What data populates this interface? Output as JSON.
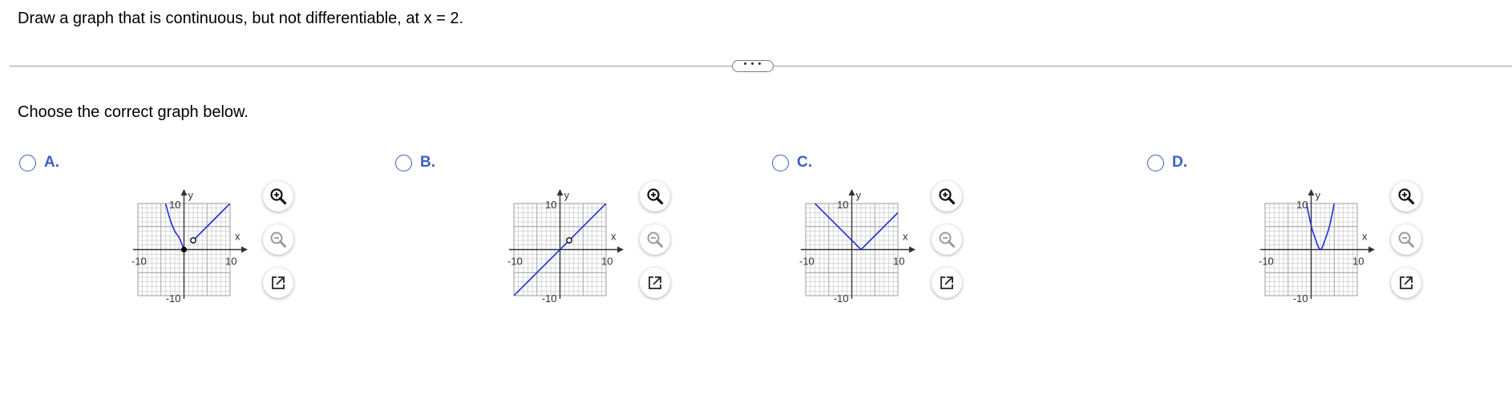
{
  "question": "Draw a graph that is continuous, but not differentiable, at x = 2.",
  "expand_label": "• • •",
  "instruction": "Choose the correct graph below.",
  "axis": {
    "x_label": "x",
    "y_label": "y",
    "min_tick": "-10",
    "max_tick": "10",
    "neg_tick": "-10"
  },
  "options": [
    {
      "letter": "A.",
      "selected": false
    },
    {
      "letter": "B.",
      "selected": false
    },
    {
      "letter": "C.",
      "selected": false
    },
    {
      "letter": "D.",
      "selected": false
    }
  ],
  "colors": {
    "accent": "#3c5dc4",
    "curve": "#1f2fd6",
    "grid": "#b5b5b5"
  },
  "icons": {
    "zoom_in": "zoom-in-icon",
    "zoom_out": "zoom-out-icon",
    "popout": "popout-icon"
  },
  "chart_data": [
    {
      "type": "line",
      "xlim": [
        -10,
        10
      ],
      "ylim": [
        -10,
        10
      ],
      "xlabel": "x",
      "ylabel": "y",
      "series": [
        {
          "x": [
            -4,
            -3,
            -2,
            -1,
            0
          ],
          "y": [
            10.0,
            6.5,
            4.0,
            2.5,
            0.0
          ]
        },
        {
          "x": [
            2,
            4,
            6,
            8,
            10
          ],
          "y": [
            2,
            4,
            6,
            8,
            10
          ]
        }
      ],
      "closed_points": [
        [
          0,
          0
        ]
      ],
      "open_points": [
        [
          2,
          2
        ]
      ]
    },
    {
      "type": "line",
      "xlim": [
        -10,
        10
      ],
      "ylim": [
        -10,
        10
      ],
      "xlabel": "x",
      "ylabel": "y",
      "series": [
        {
          "x": [
            -10,
            10
          ],
          "y": [
            -10,
            10
          ]
        }
      ],
      "closed_points": [],
      "open_points": [
        [
          2,
          2
        ]
      ]
    },
    {
      "type": "line",
      "xlim": [
        -10,
        10
      ],
      "ylim": [
        -10,
        10
      ],
      "xlabel": "x",
      "ylabel": "y",
      "series": [
        {
          "x": [
            -8,
            2,
            10
          ],
          "y": [
            10,
            0,
            8
          ]
        }
      ],
      "closed_points": [],
      "open_points": []
    },
    {
      "type": "line",
      "xlim": [
        -10,
        10
      ],
      "ylim": [
        -10,
        10
      ],
      "xlabel": "x",
      "ylabel": "y",
      "series": [
        {
          "x": [
            -1,
            0,
            1,
            2,
            3,
            4,
            5
          ],
          "y": [
            10.0,
            5.2,
            2.1,
            0.0,
            2.1,
            5.2,
            10.0
          ]
        }
      ],
      "closed_points": [],
      "open_points": []
    }
  ]
}
